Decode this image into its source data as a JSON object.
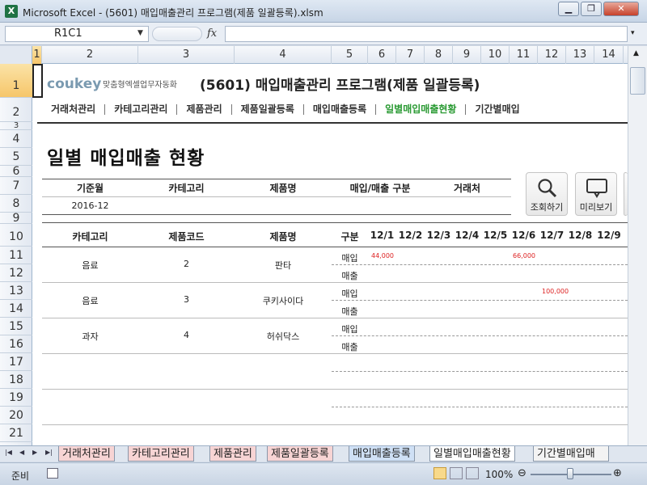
{
  "window": {
    "app_icon": "excel-icon",
    "title": "Microsoft Excel - (5601) 매입매출관리 프로그램(제품 일괄등록).xlsm",
    "buttons": [
      "minimize-icon",
      "restore-icon",
      "close-icon"
    ]
  },
  "formula_bar": {
    "name_box": "R1C1",
    "fx_label": "fx",
    "formula": ""
  },
  "columns": [
    "1",
    "2",
    "3",
    "4",
    "5",
    "6",
    "7",
    "8",
    "9",
    "10",
    "11",
    "12",
    "13",
    "14"
  ],
  "rows": [
    "1",
    "2",
    "3",
    "4",
    "5",
    "6",
    "7",
    "8",
    "9",
    "10",
    "11",
    "12",
    "13",
    "14",
    "15",
    "16",
    "17",
    "18",
    "19",
    "20",
    "21"
  ],
  "sheet": {
    "brand": "coukey",
    "brand_sub": "맞춤형엑셀업무자동화",
    "program_title": "(5601) 매입매출관리 프로그램(제품 일괄등록)",
    "nav": [
      "거래처관리",
      "카테고리관리",
      "제품관리",
      "제품일괄등록",
      "매입매출등록",
      "일별매입매출현황",
      "기간별매입"
    ],
    "active_nav": "일별매입매출현황",
    "heading": "일별 매입매출 현황",
    "filter_headers": [
      "기준월",
      "카테고리",
      "제품명",
      "매입/매출 구분",
      "거래처"
    ],
    "filter_values": {
      "month": "2016-12",
      "category": "",
      "product": "",
      "type": "",
      "vendor": ""
    },
    "buttons": {
      "search": "조회하기",
      "preview": "미리보기"
    },
    "table_headers": [
      "카테고리",
      "제품코드",
      "제품명",
      "구분"
    ],
    "date_headers": [
      "12/1",
      "12/2",
      "12/3",
      "12/4",
      "12/5",
      "12/6",
      "12/7",
      "12/8",
      "12/9"
    ],
    "table_rows": [
      {
        "category": "음료",
        "code": "2",
        "name": "판타",
        "buy_label": "매입",
        "sell_label": "매출",
        "buy": {
          "12/1": "44,000",
          "12/6": "66,000"
        }
      },
      {
        "category": "음료",
        "code": "3",
        "name": "쿠키사이다",
        "buy_label": "매입",
        "sell_label": "매출",
        "buy": {
          "12/7": "100,000"
        }
      },
      {
        "category": "과자",
        "code": "4",
        "name": "허쉬닥스",
        "buy_label": "매입",
        "sell_label": "매출",
        "buy": {}
      }
    ]
  },
  "sheet_tabs": [
    "거래처관리",
    "카테고리관리",
    "제품관리",
    "제품일괄등록",
    "매입매출등록",
    "일별매입매출현황",
    "기간별매입매"
  ],
  "active_tab": "일별매입매출현황",
  "status": {
    "ready": "준비",
    "zoom": "100%"
  },
  "colors": {
    "accent_green": "#2a9a33",
    "amount_red": "#dd2222",
    "tab_pink": "#f7d4d4",
    "tab_blue": "#cfe0f5"
  }
}
